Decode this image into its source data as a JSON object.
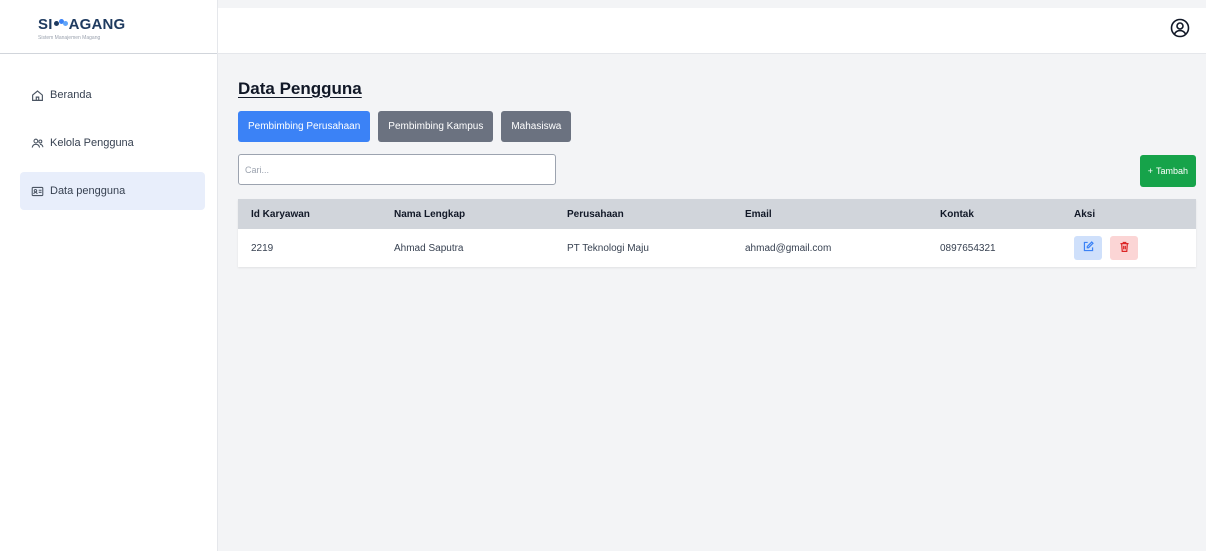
{
  "brand": {
    "name_left": "SI",
    "name_right": "AGANG",
    "tagline": "Sistem Manajemen Magang"
  },
  "sidebar": {
    "items": [
      {
        "label": "Beranda",
        "icon": "home-icon"
      },
      {
        "label": "Kelola Pengguna",
        "icon": "users-icon"
      },
      {
        "label": "Data pengguna",
        "icon": "id-card-icon"
      }
    ]
  },
  "header": {
    "profile_icon": "user-circle-icon"
  },
  "main": {
    "title": "Data Pengguna",
    "tabs": [
      {
        "label": "Pembimbing Perusahaan"
      },
      {
        "label": "Pembimbing Kampus"
      },
      {
        "label": "Mahasiswa"
      }
    ],
    "search": {
      "placeholder": "Cari..."
    },
    "add_button": {
      "label": "Tambah"
    },
    "table": {
      "columns": [
        "Id Karyawan",
        "Nama Lengkap",
        "Perusahaan",
        "Email",
        "Kontak",
        "Aksi"
      ],
      "rows": [
        {
          "id": "2219",
          "name": "Ahmad Saputra",
          "company": "PT Teknologi Maju",
          "email": "ahmad@gmail.com",
          "contact": "0897654321"
        }
      ]
    }
  },
  "colors": {
    "primary": "#3b82f6",
    "secondary": "#6b7280",
    "success": "#16a34a",
    "danger": "#dc2626"
  }
}
